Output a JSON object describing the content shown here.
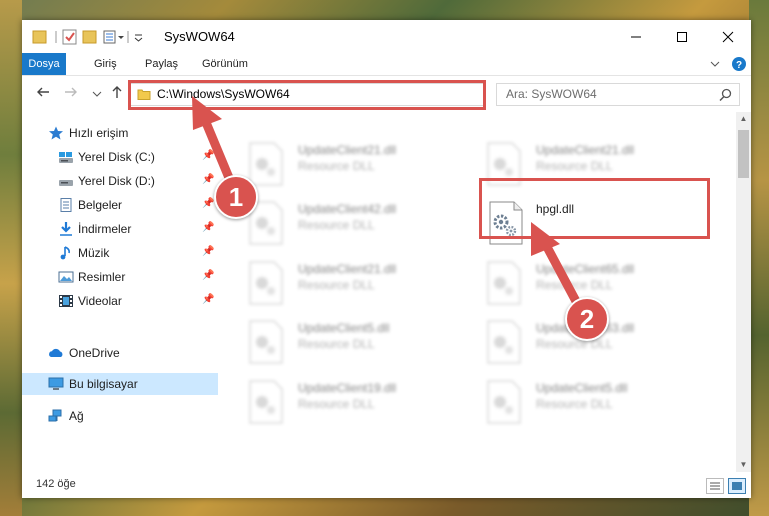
{
  "window": {
    "title": "SysWOW64"
  },
  "ribbon": {
    "tabs": [
      "Dosya",
      "Giriş",
      "Paylaş",
      "Görünüm"
    ]
  },
  "address": {
    "path": "C:\\Windows\\SysWOW64"
  },
  "search": {
    "placeholder": "Ara: SysWOW64"
  },
  "nav": {
    "quick_access": "Hızlı erişim",
    "items": [
      "Yerel Disk (C:)",
      "Yerel Disk (D:)",
      "Belgeler",
      "İndirmeler",
      "Müzik",
      "Resimler",
      "Videolar"
    ],
    "onedrive": "OneDrive",
    "this_pc": "Bu bilgisayar",
    "network": "Ağ"
  },
  "files": [
    {
      "name": "UpdateClient21.dll",
      "type": "Resource DLL",
      "blurred": true
    },
    {
      "name": "UpdateClient21.dll",
      "type": "Resource DLL",
      "blurred": true
    },
    {
      "name": "UpdateClient42.dll",
      "type": "Resource DLL",
      "blurred": true
    },
    {
      "name": "hpgl.dll",
      "type": "",
      "blurred": false
    },
    {
      "name": "UpdateClient21.dll",
      "type": "Resource DLL",
      "blurred": true
    },
    {
      "name": "UpdateClient65.dll",
      "type": "Resource DLL",
      "blurred": true
    },
    {
      "name": "UpdateClient5.dll",
      "type": "Resource DLL",
      "blurred": true
    },
    {
      "name": "UpdateClient63.dll",
      "type": "Resource DLL",
      "blurred": true
    },
    {
      "name": "UpdateClient19.dll",
      "type": "Resource DLL",
      "blurred": true
    },
    {
      "name": "UpdateClient5.dll",
      "type": "Resource DLL",
      "blurred": true
    }
  ],
  "status": {
    "count": "142 öğe"
  },
  "annotations": {
    "step1": "1",
    "step2": "2"
  },
  "colors": {
    "accent": "#1979ca",
    "highlight": "#d9534f",
    "selected": "#cce8ff"
  }
}
